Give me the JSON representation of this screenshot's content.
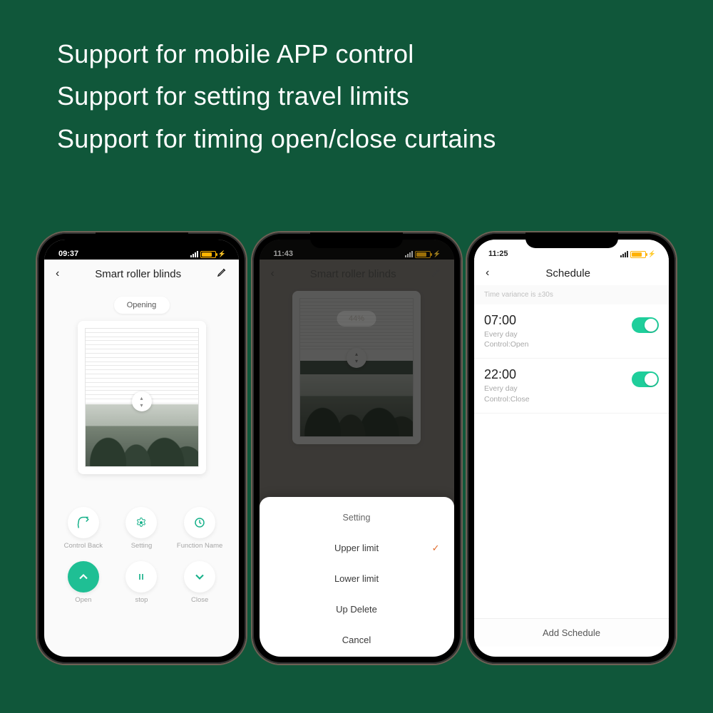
{
  "headlines": {
    "line1": "Support for mobile APP control",
    "line2": "Support for setting travel limits",
    "line3": "Support for timing open/close curtains"
  },
  "phone1": {
    "time": "09:37",
    "title": "Smart roller blinds",
    "status_pill": "Opening",
    "ctrl_back": "Control Back",
    "ctrl_setting": "Setting",
    "ctrl_function": "Function Name",
    "open": "Open",
    "stop": "stop",
    "close": "Close"
  },
  "phone2": {
    "time": "11:43",
    "title": "Smart roller blinds",
    "percent": "44%",
    "sheet": {
      "title": "Setting",
      "opt1": "Upper limit",
      "opt2": "Lower limit",
      "opt3": "Up Delete",
      "cancel": "Cancel"
    }
  },
  "phone3": {
    "time": "11:25",
    "title": "Schedule",
    "variance": "Time variance is ±30s",
    "items": [
      {
        "time": "07:00",
        "repeat": "Every day",
        "control": "Control:Open"
      },
      {
        "time": "22:00",
        "repeat": "Every day",
        "control": "Control:Close"
      }
    ],
    "add": "Add Schedule"
  }
}
